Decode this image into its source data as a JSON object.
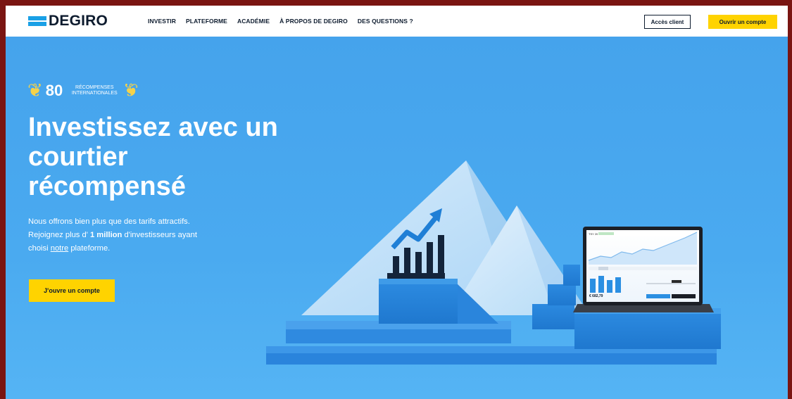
{
  "header": {
    "logo_text": "DEGIRO",
    "nav": [
      "INVESTIR",
      "PLATEFORME",
      "ACADÉMIE",
      "À PROPOS DE DEGIRO",
      "DES QUESTIONS ?"
    ],
    "client_button": "Accès client",
    "open_button": "Ouvrir un compte"
  },
  "hero": {
    "award_number": "80",
    "award_label_line1": "RÉCOMPENSES",
    "award_label_line2": "INTERNATIONALES",
    "headline": "Investissez avec un courtier récompensé",
    "sub_1": "Nous offrons bien plus que des tarifs attractifs.",
    "sub_2a": "Rejoignez plus d' ",
    "sub_2b": "1 million",
    "sub_2c": " d'investisseurs ayant",
    "sub_3a": "choisi ",
    "sub_3b": "notre",
    "sub_3c": " plateforme.",
    "cta": "J'ouvre un compte"
  },
  "laptop": {
    "amount": "€ 682,79"
  },
  "colors": {
    "brand_blue": "#1aa0e6",
    "hero_blue": "#4aa6ec",
    "cta_yellow": "#ffd300",
    "ink": "#0d1b2e"
  }
}
